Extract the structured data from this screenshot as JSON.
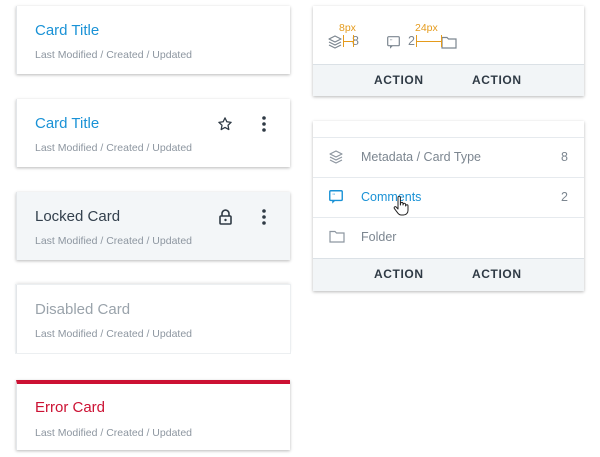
{
  "cards": [
    {
      "title": "Card Title",
      "meta": "Last Modified / Created / Updated"
    },
    {
      "title": "Card Title",
      "meta": "Last Modified / Created / Updated"
    },
    {
      "title": "Locked Card",
      "meta": "Last Modified / Created / Updated"
    },
    {
      "title": "Disabled Card",
      "meta": "Last Modified / Created / Updated"
    },
    {
      "title": "Error Card",
      "meta": "Last Modified / Created / Updated"
    }
  ],
  "top_right_card": {
    "layers_count": "8",
    "comments_count": "2",
    "spacing_small": "8px",
    "spacing_large": "24px",
    "action_1": "ACTION",
    "action_2": "ACTION"
  },
  "list_card": {
    "rows": [
      {
        "label": "Metadata / Card Type",
        "count": "8",
        "icon": "layers-icon"
      },
      {
        "label": "Comments",
        "count": "2",
        "icon": "comment-icon"
      },
      {
        "label": "Folder",
        "count": "",
        "icon": "folder-icon"
      }
    ],
    "action_1": "ACTION",
    "action_2": "ACTION"
  },
  "colors": {
    "accent": "#1a92d6",
    "error": "#cc1133",
    "measurement": "#e59b1c"
  }
}
